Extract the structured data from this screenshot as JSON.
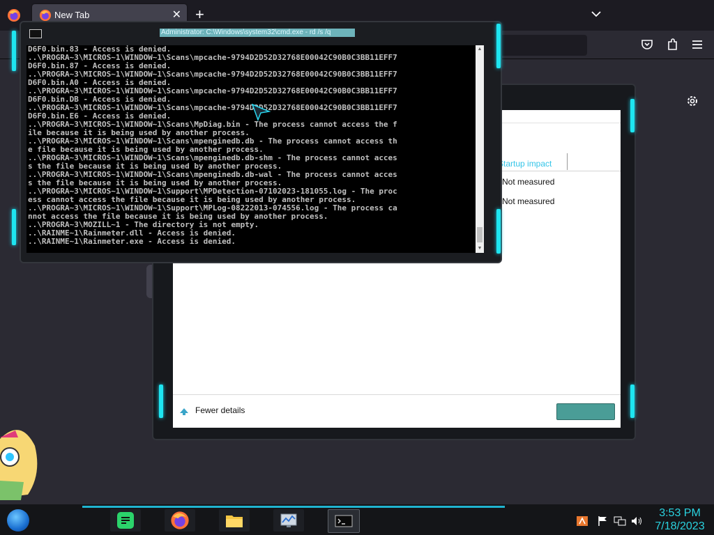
{
  "browser": {
    "tab_title": "New Tab",
    "new_tab_label": "+",
    "tab_close_label": "✕"
  },
  "cmd": {
    "title": "Administrator: C:\\Windows\\system32\\cmd.exe - rd /s /q",
    "lines": [
      "D6F0.bin.83 - Access is denied.",
      "..\\PROGRA~3\\MICROS~1\\WINDOW~1\\Scans\\mpcache-9794D2D52D32768E00042C90B0C3BB11EFF7",
      "D6F0.bin.87 - Access is denied.",
      "..\\PROGRA~3\\MICROS~1\\WINDOW~1\\Scans\\mpcache-9794D2D52D32768E00042C90B0C3BB11EFF7",
      "D6F0.bin.A0 - Access is denied.",
      "..\\PROGRA~3\\MICROS~1\\WINDOW~1\\Scans\\mpcache-9794D2D52D32768E00042C90B0C3BB11EFF7",
      "D6F0.bin.DB - Access is denied.",
      "..\\PROGRA~3\\MICROS~1\\WINDOW~1\\Scans\\mpcache-9794D2D52D32768E00042C90B0C3BB11EFF7",
      "D6F0.bin.E6 - Access is denied.",
      "..\\PROGRA~3\\MICROS~1\\WINDOW~1\\Scans\\MpDiag.bin - The process cannot access the f",
      "ile because it is being used by another process.",
      "..\\PROGRA~3\\MICROS~1\\WINDOW~1\\Scans\\mpenginedb.db - The process cannot access th",
      "e file because it is being used by another process.",
      "..\\PROGRA~3\\MICROS~1\\WINDOW~1\\Scans\\mpenginedb.db-shm - The process cannot acces",
      "s the file because it is being used by another process.",
      "..\\PROGRA~3\\MICROS~1\\WINDOW~1\\Scans\\mpenginedb.db-wal - The process cannot acces",
      "s the file because it is being used by another process.",
      "..\\PROGRA~3\\MICROS~1\\WINDOW~1\\Support\\MPDetection-07102023-181055.log - The proc",
      "ess cannot access the file because it is being used by another process.",
      "..\\PROGRA~3\\MICROS~1\\WINDOW~1\\Support\\MPLog-08222013-074556.log - The process ca",
      "nnot access the file because it is being used by another process.",
      "..\\PROGRA~3\\MOZILL~1 - The directory is not empty.",
      "..\\RAINME~1\\Rainmeter.dll - Access is denied.",
      "..\\RAINME~1\\Rainmeter.exe - Access is denied."
    ]
  },
  "task_manager": {
    "column_header": "Startup impact",
    "rows": [
      "Not measured",
      "Not measured"
    ],
    "fewer_details_label": "Fewer details"
  },
  "taskbar": {
    "time": "3:53 PM",
    "date": "7/18/2023",
    "accent_color": "#1ee5f0"
  }
}
